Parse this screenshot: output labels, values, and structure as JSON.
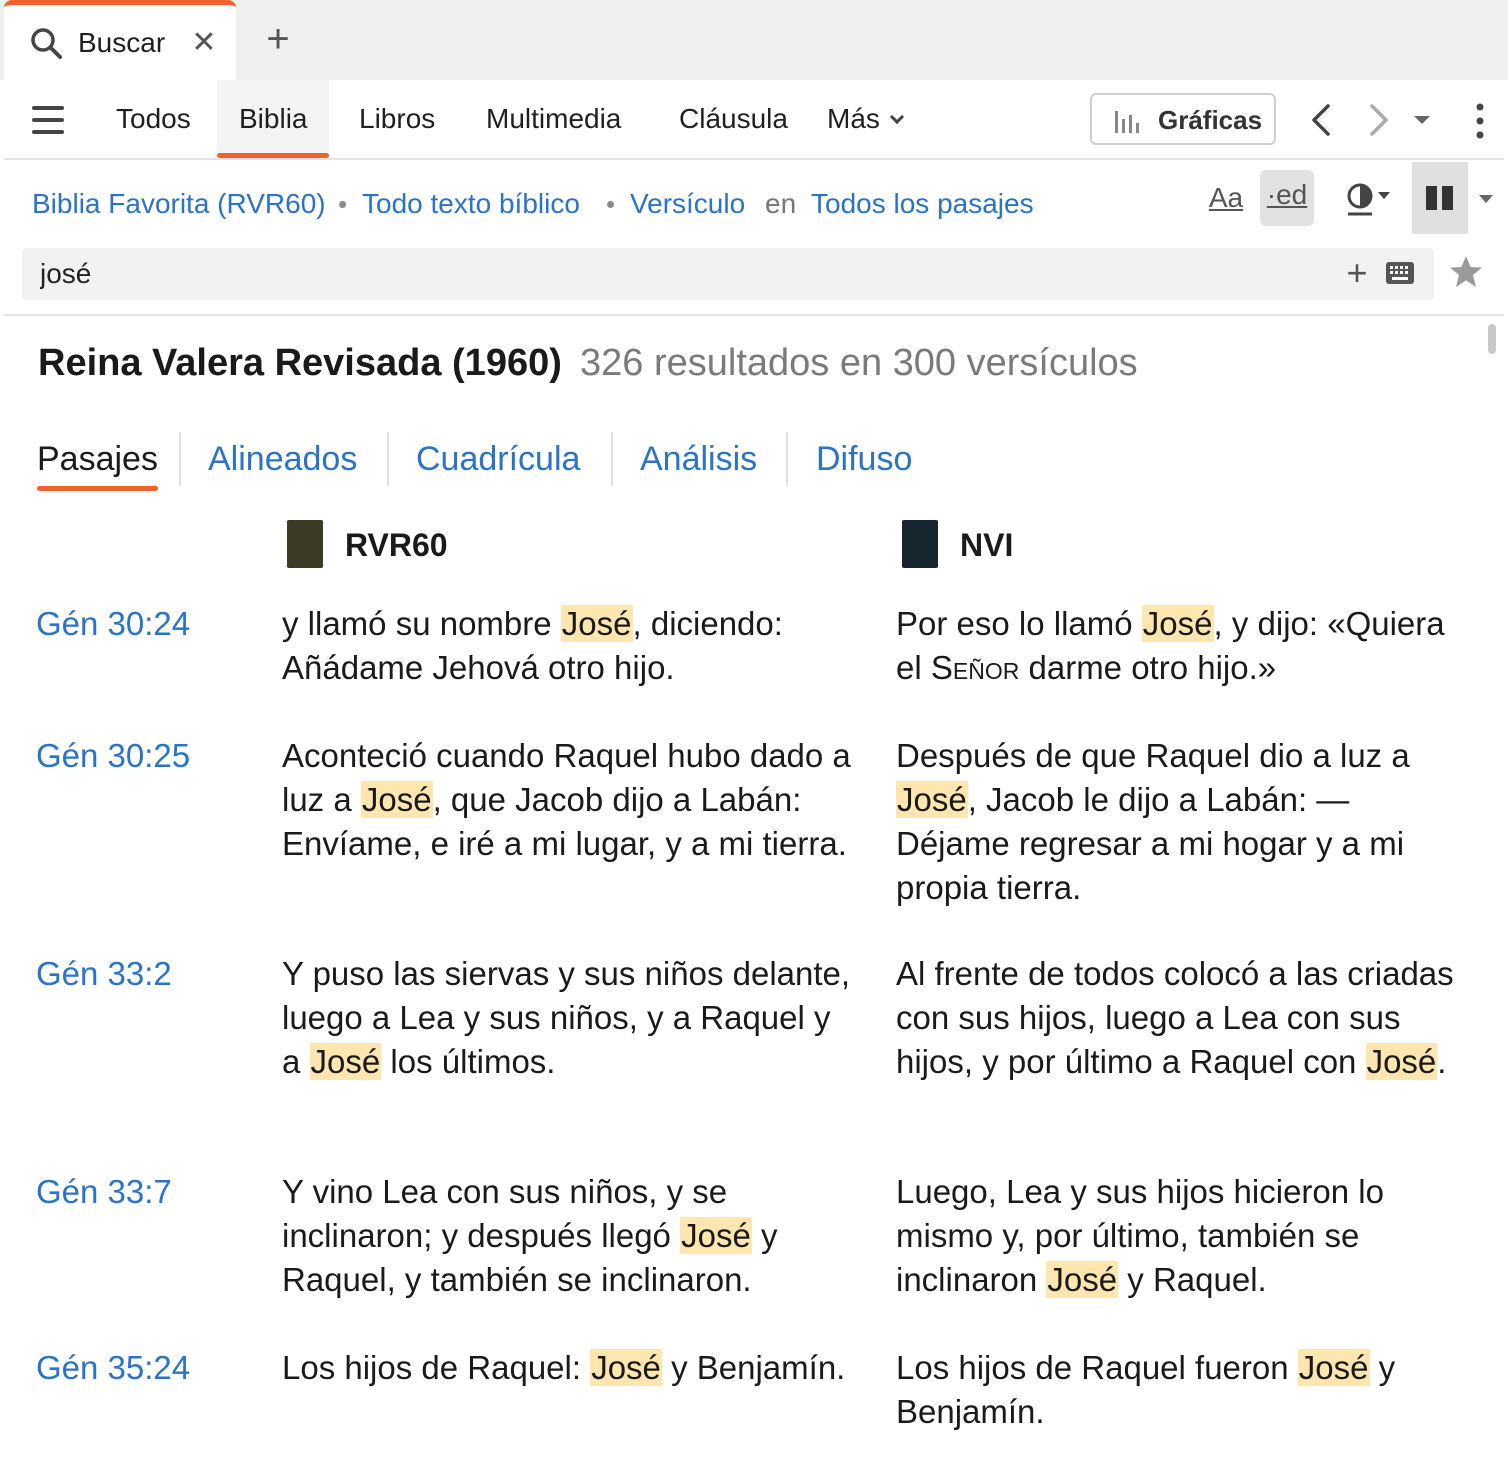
{
  "tab": {
    "title": "Buscar",
    "close": "✕",
    "add": "+"
  },
  "nav": {
    "items": [
      {
        "label": "Todos"
      },
      {
        "label": "Biblia"
      },
      {
        "label": "Libros"
      },
      {
        "label": "Multimedia"
      },
      {
        "label": "Cláusula"
      },
      {
        "label": "Más"
      }
    ],
    "active": "Biblia",
    "graficas_label": "Gráficas"
  },
  "config": {
    "bible": "Biblia Favorita (RVR60)",
    "scope": "Todo texto bíblico",
    "unit": "Versículo",
    "in_label": "en",
    "range": "Todos los pasajes",
    "font_tool": "Aa",
    "ed_tool": "·ed"
  },
  "search": {
    "value": "josé",
    "plus": "+"
  },
  "results": {
    "title": "Reina Valera Revisada (1960)",
    "count": "326 resultados en 300 versículos"
  },
  "view_tabs": [
    {
      "label": "Pasajes",
      "active": true
    },
    {
      "label": "Alineados"
    },
    {
      "label": "Cuadrícula"
    },
    {
      "label": "Análisis"
    },
    {
      "label": "Difuso"
    }
  ],
  "columns": [
    {
      "label": "RVR60",
      "cover_color": "#3b3a26"
    },
    {
      "label": "NVI",
      "cover_color": "#16262f"
    }
  ],
  "verses": [
    {
      "ref": "Gén 30:24",
      "rvr": {
        "before": "y llamó su nombre ",
        "hit": "José",
        "after": ", diciendo: Añádame Jehová otro hijo."
      },
      "nvi": {
        "before": "Por eso lo llamó ",
        "hit": "José",
        "after": ", y dijo: «Quiera el ",
        "sc": "Señor",
        "tail": " darme otro hijo.»"
      }
    },
    {
      "ref": "Gén 30:25",
      "rvr": {
        "before": "Aconteció cuando Raquel hubo dado a luz a ",
        "hit": "José",
        "after": ", que Jacob dijo a Labán: Envíame, e iré a mi lugar, y a mi tierra."
      },
      "nvi": {
        "before": "Después de que Raquel dio a luz a ",
        "hit": "José",
        "after": ", Jacob le dijo a Labán: —Déjame regresar a mi hogar y a mi propia tierra."
      }
    },
    {
      "ref": "Gén 33:2",
      "rvr": {
        "before": "Y puso las siervas y sus niños delante, luego a Lea y sus niños, y a Raquel y a ",
        "hit": "José",
        "after": " los últimos."
      },
      "nvi": {
        "before": "Al frente de todos colocó a las criadas con sus hijos, luego a Lea con sus hijos, y por último a Raquel con ",
        "hit": "José",
        "after": "."
      }
    },
    {
      "ref": "Gén 33:7",
      "rvr": {
        "before": "Y vino Lea con sus niños, y se inclinaron; y después llegó ",
        "hit": "José",
        "after": " y Raquel, y también se inclinaron."
      },
      "nvi": {
        "before": "Luego, Lea y sus hijos hicieron lo mismo y, por último, también se inclinaron ",
        "hit": "José",
        "after": " y Raquel."
      }
    },
    {
      "ref": "Gén 35:24",
      "rvr": {
        "before": "Los hijos de Raquel: ",
        "hit": "José",
        "after": " y Benjamín."
      },
      "nvi": {
        "before": "Los hijos de Raquel fueron ",
        "hit": "José",
        "after": " y Benjamín."
      }
    }
  ],
  "colors": {
    "accent": "#f0622b",
    "link": "#2a73c6",
    "highlight": "#fde6b0"
  }
}
